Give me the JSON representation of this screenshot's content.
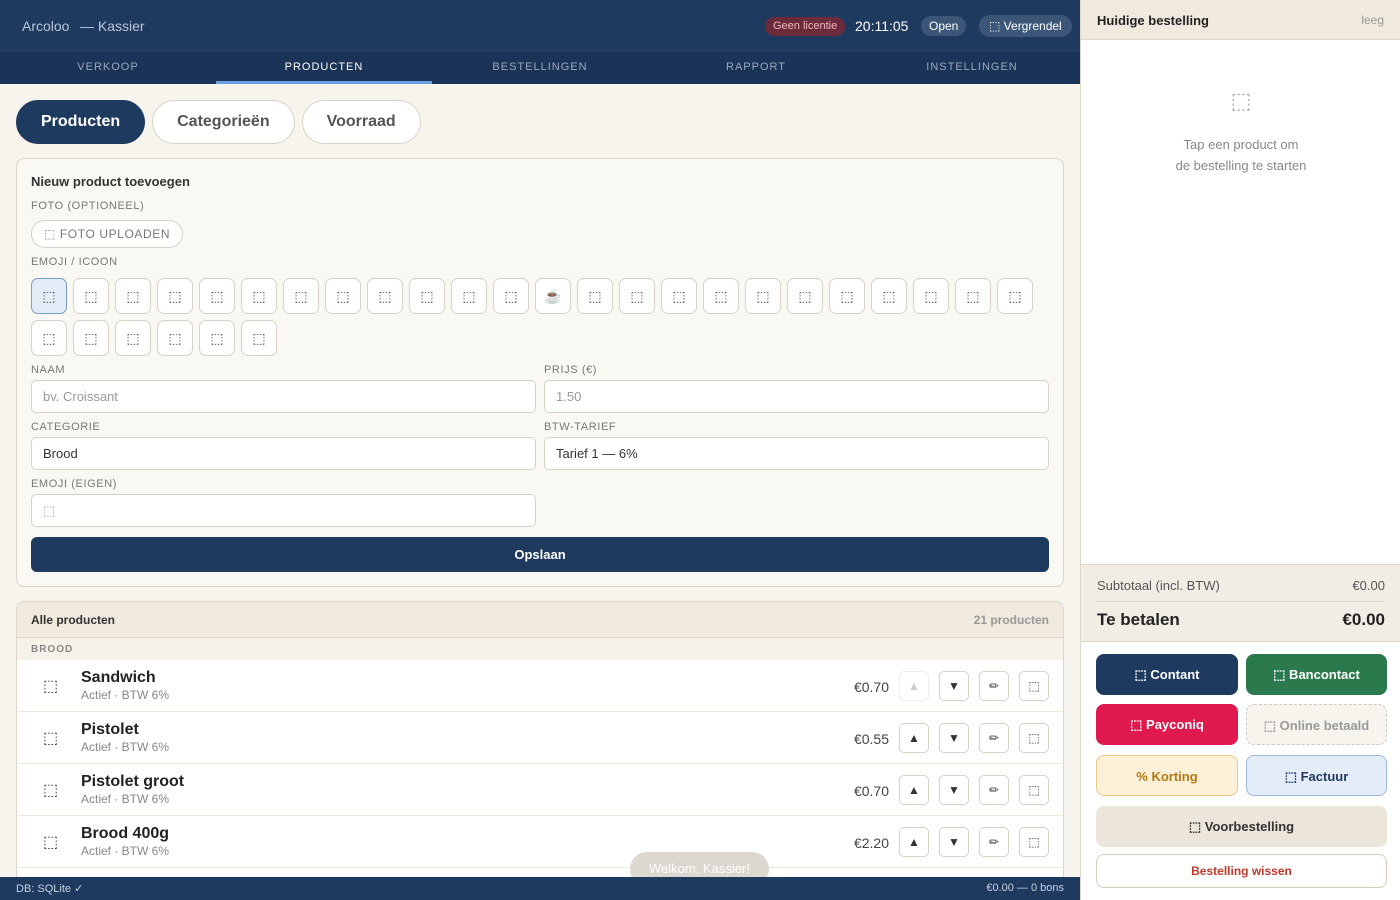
{
  "header": {
    "app": "Arcoloo",
    "subtitle": "— Kassier",
    "license": "Geen licentie",
    "time": "20:11:05",
    "status": "Open",
    "lock": "⬚ Vergrendel"
  },
  "nav": [
    {
      "label": "VERKOOP",
      "active": false
    },
    {
      "label": "PRODUCTEN",
      "active": true
    },
    {
      "label": "BESTELLINGEN",
      "active": false
    },
    {
      "label": "RAPPORT",
      "active": false
    },
    {
      "label": "INSTELLINGEN",
      "active": false
    }
  ],
  "subtabs": [
    {
      "label": "Producten",
      "active": true
    },
    {
      "label": "Categorieën",
      "active": false
    },
    {
      "label": "Voorraad",
      "active": false
    }
  ],
  "form": {
    "title": "Nieuw product toevoegen",
    "photo_label": "FOTO (OPTIONEEL)",
    "upload_label": "⬚ FOTO UPLOADEN",
    "emoji_label": "EMOJI / ICOON",
    "emojis": [
      "⬚",
      "⬚",
      "⬚",
      "⬚",
      "⬚",
      "⬚",
      "⬚",
      "⬚",
      "⬚",
      "⬚",
      "⬚",
      "⬚",
      "☕",
      "⬚",
      "⬚",
      "⬚",
      "⬚",
      "⬚",
      "⬚",
      "⬚",
      "⬚",
      "⬚",
      "⬚",
      "⬚",
      "⬚",
      "⬚",
      "⬚",
      "⬚",
      "⬚",
      "⬚"
    ],
    "name_label": "NAAM",
    "name_placeholder": "bv. Croissant",
    "price_label": "PRIJS (€)",
    "price_placeholder": "1.50",
    "category_label": "CATEGORIE",
    "category_value": "Brood",
    "vat_label": "BTW-TARIEF",
    "vat_value": "Tarief 1 — 6%",
    "emoji_own_label": "EMOJI (EIGEN)",
    "emoji_own_value": "⬚",
    "save_label": "Opslaan"
  },
  "products": {
    "title": "Alle producten",
    "count": "21 producten",
    "group": "BROOD",
    "items": [
      {
        "icon": "⬚",
        "name": "Sandwich",
        "meta": "Actief · BTW 6%",
        "price": "€0.70",
        "up_disabled": true
      },
      {
        "icon": "⬚",
        "name": "Pistolet",
        "meta": "Actief · BTW 6%",
        "price": "€0.55",
        "up_disabled": false
      },
      {
        "icon": "⬚",
        "name": "Pistolet groot",
        "meta": "Actief · BTW 6%",
        "price": "€0.70",
        "up_disabled": false
      },
      {
        "icon": "⬚",
        "name": "Brood 400g",
        "meta": "Actief · BTW 6%",
        "price": "€2.20",
        "up_disabled": false
      }
    ],
    "up": "▲",
    "down": "▼",
    "edit": "✏",
    "delete": "⬚"
  },
  "toast": "Welkom, Kassier!",
  "statusbar": {
    "left": "DB: SQLite ✓",
    "right": "€0.00 — 0 bons"
  },
  "order": {
    "title": "Huidige bestelling",
    "state": "leeg",
    "empty_icon": "⬚",
    "empty_line1": "Tap een product om",
    "empty_line2": "de bestelling te starten",
    "subtotal_label": "Subtotaal (incl. BTW)",
    "subtotal": "€0.00",
    "total_label": "Te betalen",
    "total": "€0.00"
  },
  "payments": {
    "cash": "⬚ Contant",
    "bancontact": "⬚ Bancontact",
    "payconiq": "⬚ Payconiq",
    "online": "⬚ Online betaald",
    "discount": "% Korting",
    "invoice": "⬚ Factuur",
    "preorder": "⬚ Voorbestelling",
    "clear": "Bestelling wissen"
  }
}
